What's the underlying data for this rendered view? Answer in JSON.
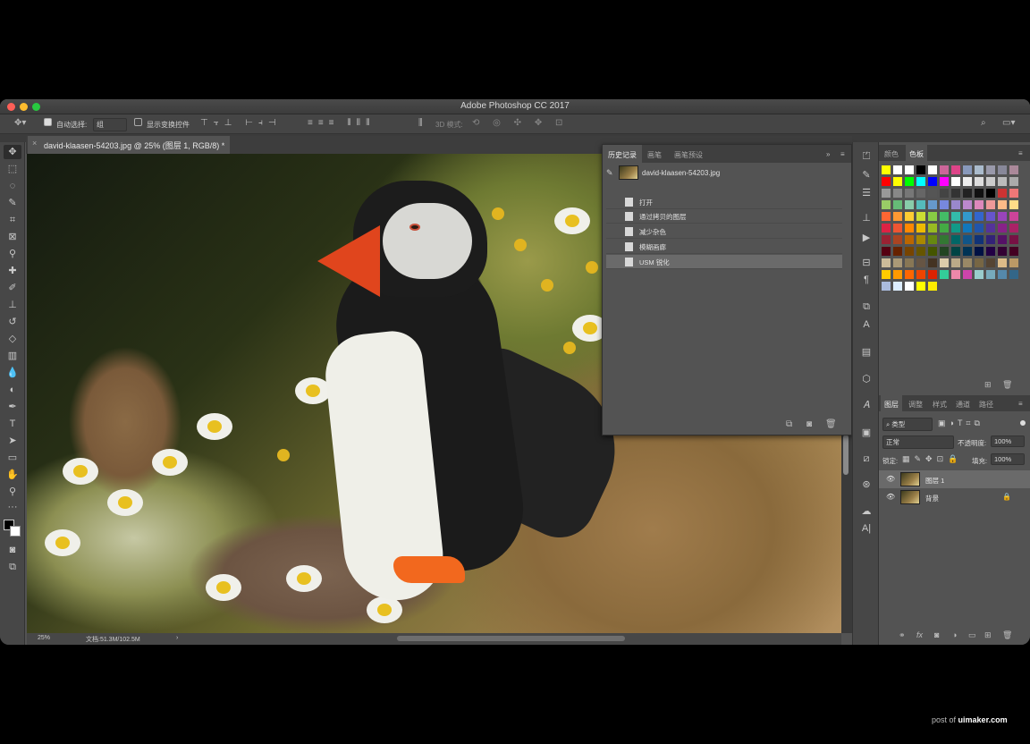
{
  "window": {
    "title": "Adobe Photoshop CC 2017"
  },
  "options_bar": {
    "auto_select_label": "自动选择:",
    "auto_select_value": "组",
    "show_transform_label": "显示变换控件",
    "mode_3d_label": "3D 模式:"
  },
  "document": {
    "tab_title": "david-klaasen-54203.jpg @ 25% (图层 1, RGB/8) *",
    "close_glyph": "×",
    "zoom": "25%",
    "doc_size": "文档:51.3M/102.5M",
    "status_arrow": "›"
  },
  "history_panel": {
    "tabs": [
      "历史记录",
      "画笔",
      "画笔预设"
    ],
    "snapshot_name": "david-klaasen-54203.jpg",
    "steps": [
      "打开",
      "通过拷贝的图层",
      "减少杂色",
      "模糊画廊",
      "USM 锐化"
    ],
    "selected_step": 4,
    "menu_glyph": "»"
  },
  "color_panel": {
    "tabs": [
      "颜色",
      "色板"
    ],
    "active_tab": 1
  },
  "layers_panel": {
    "tabs": [
      "图层",
      "调整",
      "样式",
      "通道",
      "路径"
    ],
    "filter_label": "类型",
    "blend_mode": "正常",
    "opacity_label": "不透明度:",
    "opacity_value": "100%",
    "lock_label": "锁定:",
    "fill_label": "填充:",
    "fill_value": "100%",
    "layers": [
      {
        "name": "图层 1",
        "selected": true,
        "locked": false
      },
      {
        "name": "背景",
        "selected": false,
        "locked": true
      }
    ]
  },
  "watermark": {
    "prefix": "post of",
    "brand": "uimaker.com"
  },
  "colors": {
    "accent_selected": "#6a6a6a",
    "panel_bg": "#535353",
    "traffic_close": "#fe5f57",
    "traffic_min": "#febc2e",
    "traffic_max": "#28c840"
  },
  "icons": {
    "toolbar": [
      "move-icon",
      "marquee-icon",
      "lasso-icon",
      "quick-select-icon",
      "crop-icon",
      "frame-icon",
      "eyedropper-icon",
      "healing-icon",
      "brush-icon",
      "stamp-icon",
      "history-brush-icon",
      "eraser-icon",
      "gradient-icon",
      "blur-icon",
      "dodge-icon",
      "pen-icon",
      "type-icon",
      "path-select-icon",
      "shape-icon",
      "hand-icon",
      "zoom-icon",
      "more-icon"
    ]
  }
}
